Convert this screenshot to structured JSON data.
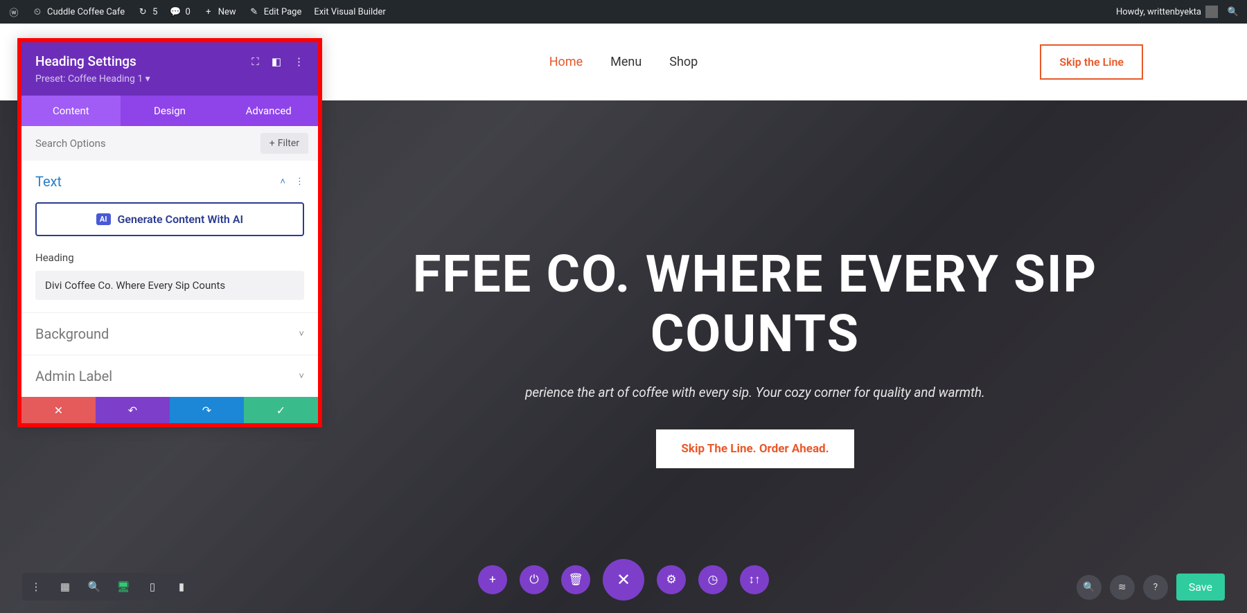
{
  "wp_bar": {
    "site_name": "Cuddle Coffee Cafe",
    "updates": "5",
    "comments": "0",
    "new": "New",
    "edit": "Edit Page",
    "exit": "Exit Visual Builder",
    "howdy": "Howdy, writtenbyekta"
  },
  "nav": {
    "home": "Home",
    "menu": "Menu",
    "shop": "Shop",
    "cta": "Skip the Line"
  },
  "hero": {
    "title": "FFEE CO. WHERE EVERY SIP COUNTS",
    "subtitle": "perience the art of coffee with every sip. Your cozy corner for quality and warmth.",
    "button": "Skip The Line. Order Ahead."
  },
  "panel": {
    "title": "Heading Settings",
    "preset": "Preset: Coffee Heading 1 ▾",
    "tabs": {
      "content": "Content",
      "design": "Design",
      "advanced": "Advanced"
    },
    "search_placeholder": "Search Options",
    "filter": "Filter",
    "section_text": "Text",
    "ai_button": "Generate Content With AI",
    "ai_badge": "AI",
    "heading_label": "Heading",
    "heading_value": "Divi Coffee Co. Where Every Sip Counts",
    "section_background": "Background",
    "section_admin": "Admin Label"
  },
  "bottom": {
    "save": "Save"
  }
}
